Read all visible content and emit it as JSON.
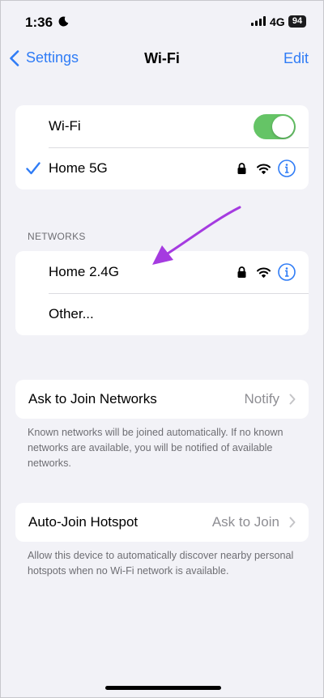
{
  "status_bar": {
    "time": "1:36",
    "network": "4G",
    "battery": "94"
  },
  "nav": {
    "back_label": "Settings",
    "title": "Wi-Fi",
    "edit_label": "Edit"
  },
  "wifi_group": {
    "toggle_label": "Wi-Fi",
    "toggle_on": true,
    "connected_network": "Home 5G"
  },
  "networks_section": {
    "header": "NETWORKS",
    "items": [
      {
        "label": "Home 2.4G"
      },
      {
        "label": "Other..."
      }
    ]
  },
  "ask_to_join": {
    "label": "Ask to Join Networks",
    "value": "Notify",
    "footnote": "Known networks will be joined automatically. If no known networks are available, you will be notified of available networks."
  },
  "auto_join": {
    "label": "Auto-Join Hotspot",
    "value": "Ask to Join",
    "footnote": "Allow this device to automatically discover nearby personal hotspots when no Wi-Fi network is available."
  },
  "colors": {
    "accent": "#2f7cf6",
    "toggle_on": "#65c466",
    "annotation_arrow": "#a53be0",
    "background": "#f2f2f7"
  }
}
